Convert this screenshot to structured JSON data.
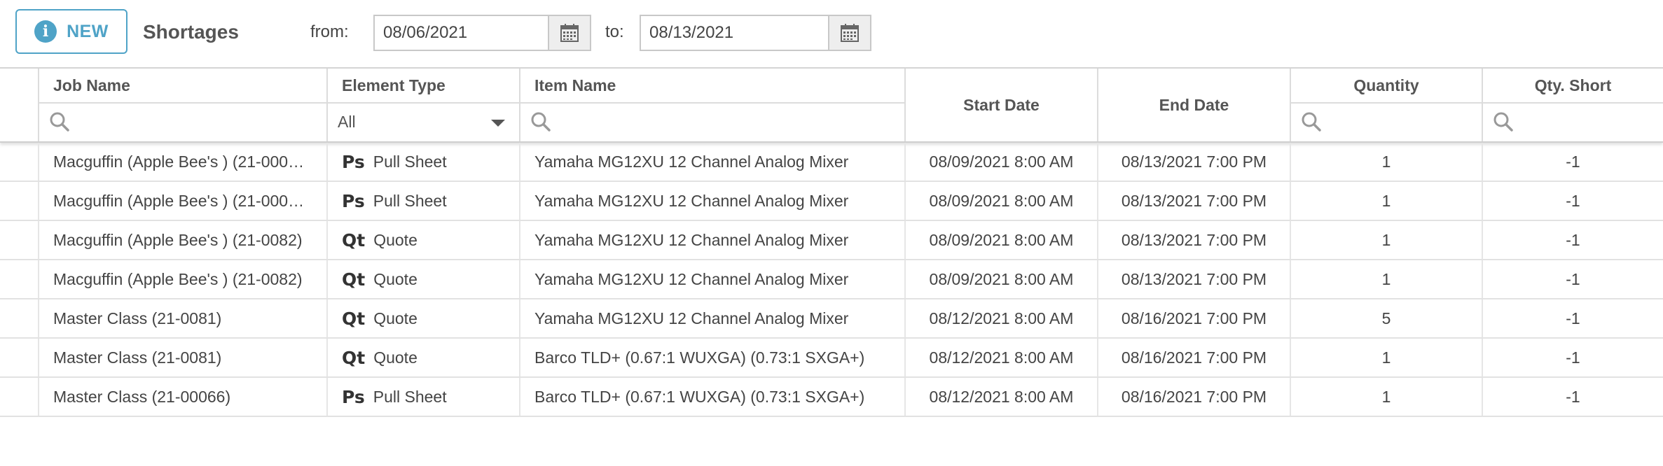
{
  "toolbar": {
    "new_label": "NEW",
    "title": "Shortages",
    "from_label": "from:",
    "from_value": "08/06/2021",
    "to_label": "to:",
    "to_value": "08/13/2021"
  },
  "columns": {
    "job_name": "Job Name",
    "element_type": "Element Type",
    "element_type_filter": "All",
    "item_name": "Item Name",
    "start_date": "Start Date",
    "end_date": "End Date",
    "quantity": "Quantity",
    "qty_short": "Qty. Short"
  },
  "rows": [
    {
      "job": "Macguffin (Apple Bee's ) (21-000…",
      "etype_icon": "Ps",
      "etype": "Pull Sheet",
      "item": "Yamaha MG12XU 12 Channel Analog Mixer",
      "start": "08/09/2021 8:00 AM",
      "end": "08/13/2021 7:00 PM",
      "qty": "1",
      "short": "-1"
    },
    {
      "job": "Macguffin (Apple Bee's ) (21-000…",
      "etype_icon": "Ps",
      "etype": "Pull Sheet",
      "item": "Yamaha MG12XU 12 Channel Analog Mixer",
      "start": "08/09/2021 8:00 AM",
      "end": "08/13/2021 7:00 PM",
      "qty": "1",
      "short": "-1"
    },
    {
      "job": "Macguffin (Apple Bee's ) (21-0082)",
      "etype_icon": "Qt",
      "etype": "Quote",
      "item": "Yamaha MG12XU 12 Channel Analog Mixer",
      "start": "08/09/2021 8:00 AM",
      "end": "08/13/2021 7:00 PM",
      "qty": "1",
      "short": "-1"
    },
    {
      "job": "Macguffin (Apple Bee's ) (21-0082)",
      "etype_icon": "Qt",
      "etype": "Quote",
      "item": "Yamaha MG12XU 12 Channel Analog Mixer",
      "start": "08/09/2021 8:00 AM",
      "end": "08/13/2021 7:00 PM",
      "qty": "1",
      "short": "-1"
    },
    {
      "job": "Master Class (21-0081)",
      "etype_icon": "Qt",
      "etype": "Quote",
      "item": "Yamaha MG12XU 12 Channel Analog Mixer",
      "start": "08/12/2021 8:00 AM",
      "end": "08/16/2021 7:00 PM",
      "qty": "5",
      "short": "-1"
    },
    {
      "job": "Master Class (21-0081)",
      "etype_icon": "Qt",
      "etype": "Quote",
      "item": "Barco TLD+ (0.67:1 WUXGA) (0.73:1 SXGA+)",
      "start": "08/12/2021 8:00 AM",
      "end": "08/16/2021 7:00 PM",
      "qty": "1",
      "short": "-1"
    },
    {
      "job": "Master Class (21-00066)",
      "etype_icon": "Ps",
      "etype": "Pull Sheet",
      "item": "Barco TLD+ (0.67:1 WUXGA) (0.73:1 SXGA+)",
      "start": "08/12/2021 8:00 AM",
      "end": "08/16/2021 7:00 PM",
      "qty": "1",
      "short": "-1"
    }
  ],
  "icons": {
    "new_button": "info-icon",
    "date_picker": "calendar-icon",
    "filter": "search-icon",
    "dropdown": "caret-down-icon"
  },
  "colors": {
    "accent": "#4fa3c7"
  }
}
